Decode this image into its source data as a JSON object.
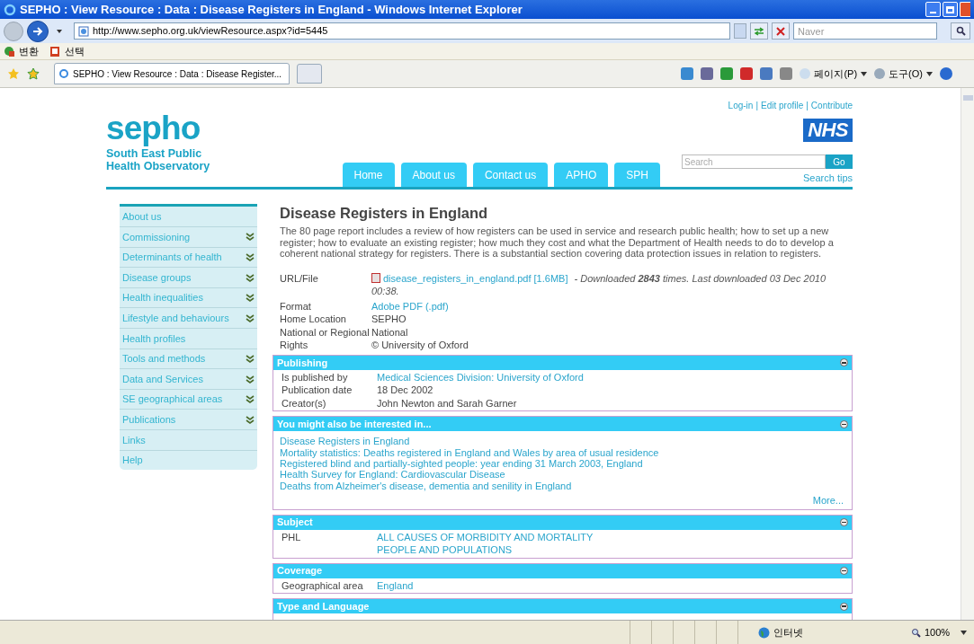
{
  "window": {
    "title": "SEPHO : View Resource : Data : Disease Registers in England - Windows Internet Explorer"
  },
  "address_bar": {
    "url": "http://www.sepho.org.uk/viewResource.aspx?id=5445",
    "search_placeholder": "Naver"
  },
  "links_toolbar": [
    "변환",
    "선택"
  ],
  "browser_tab": {
    "title": "SEPHO : View Resource : Data : Disease Register..."
  },
  "command_bar": [
    "페이지(P)",
    "도구(O)"
  ],
  "site": {
    "logo": "sepho",
    "tagline": [
      "South East Public",
      "Health Observatory"
    ],
    "nhs": "NHS",
    "top_links": [
      "Log-in",
      "Edit profile",
      "Contribute"
    ],
    "link_separator": "|",
    "nav": [
      {
        "label": "Home"
      },
      {
        "label": "About us"
      },
      {
        "label": "Contact us"
      },
      {
        "label": "APHO"
      },
      {
        "label": "SPH"
      }
    ],
    "search": {
      "placeholder": "Search",
      "button": "Go",
      "tips": "Search tips"
    }
  },
  "sidebar": {
    "items": [
      {
        "label": "About us",
        "expandable": false
      },
      {
        "label": "Commissioning",
        "expandable": true
      },
      {
        "label": "Determinants of health",
        "expandable": true
      },
      {
        "label": "Disease groups",
        "expandable": true
      },
      {
        "label": "Health inequalities",
        "expandable": true
      },
      {
        "label": "Lifestyle and behaviours",
        "expandable": true
      },
      {
        "label": "Health profiles",
        "expandable": false
      },
      {
        "label": "Tools and methods",
        "expandable": true
      },
      {
        "label": "Data and Services",
        "expandable": true
      },
      {
        "label": "SE geographical areas",
        "expandable": true
      },
      {
        "label": "Publications",
        "expandable": true
      },
      {
        "label": "Links",
        "expandable": false
      },
      {
        "label": "Help",
        "expandable": false
      }
    ]
  },
  "resource": {
    "title": "Disease Registers in England",
    "description": "The 80 page report includes a review of how registers can be used in service and research public health; how to set up a new register; how to evaluate an existing register; how much they cost and what the Department of Health needs to do to develop a coherent national strategy for registers. There is a substantial section covering data protection issues in relation to registers.",
    "fields": [
      {
        "label": "URL/File",
        "kind": "file",
        "value": "disease_registers_in_england.pdf [1.6MB]",
        "note": "- Downloaded **2843** times. Last downloaded 03 Dec 2010 00:38."
      },
      {
        "label": "Format",
        "kind": "link",
        "value": "Adobe PDF (.pdf)"
      },
      {
        "label": "Home Location",
        "kind": "text",
        "value": "SEPHO"
      },
      {
        "label": "National or Regional",
        "kind": "text",
        "value": "National"
      },
      {
        "label": "Rights",
        "kind": "text",
        "value": "© University of Oxford"
      }
    ]
  },
  "sections": [
    {
      "title": "Publishing",
      "kind": "fields",
      "rows": [
        {
          "label": "Is published by",
          "values": [
            "Medical Sciences Division: University of Oxford"
          ],
          "link": true
        },
        {
          "label": "Publication date",
          "values": [
            "18 Dec 2002"
          ],
          "link": false
        },
        {
          "label": "Creator(s)",
          "values": [
            "John Newton and Sarah Garner"
          ],
          "link": false
        }
      ]
    },
    {
      "title": "You might also be interested in...",
      "kind": "links",
      "links": [
        "Disease Registers in England",
        "Mortality statistics: Deaths registered in England and Wales by area of usual residence",
        "Registered blind and partially-sighted people: year ending 31 March 2003, England",
        "Health Survey for England: Cardiovascular Disease",
        "Deaths from Alzheimer's disease, dementia and senility in England"
      ],
      "more": "More..."
    },
    {
      "title": "Subject",
      "kind": "fields",
      "rows": [
        {
          "label": "PHL",
          "values": [
            "ALL CAUSES OF MORBIDITY AND MORTALITY",
            "PEOPLE AND POPULATIONS"
          ],
          "link": true
        }
      ]
    },
    {
      "title": "Coverage",
      "kind": "fields",
      "rows": [
        {
          "label": "Geographical area",
          "values": [
            "England"
          ],
          "link": true
        }
      ]
    },
    {
      "title": "Type and Language",
      "kind": "cut"
    }
  ],
  "status_bar": {
    "zone": "인터넷",
    "zoom": "100%"
  }
}
